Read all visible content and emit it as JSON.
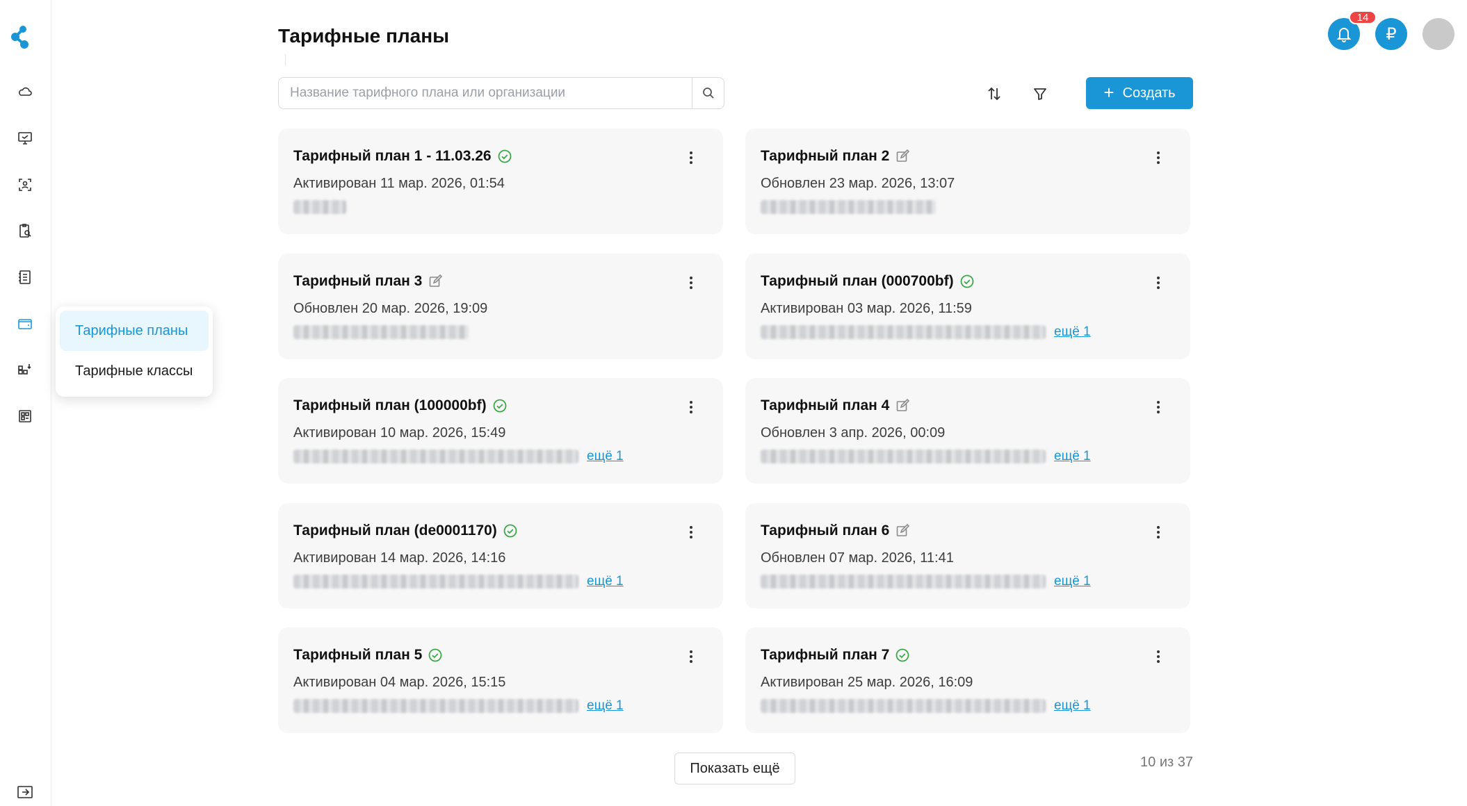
{
  "header": {
    "title": "Тарифные планы",
    "notifications_count": "14",
    "currency_symbol": "₽"
  },
  "nav": {
    "icons": [
      "cloud-icon",
      "monitor-icon",
      "scan-user-icon",
      "clipboard-search-icon",
      "notebook-icon",
      "wallet-icon",
      "hierarchy-icon",
      "widgets-icon"
    ],
    "flyout_items": [
      {
        "label": "Тарифные планы",
        "active": true
      },
      {
        "label": "Тарифные классы",
        "active": false
      }
    ]
  },
  "toolbar": {
    "search_placeholder": "Название тарифного плана или организации",
    "create_label": "Создать"
  },
  "plans": [
    {
      "title": "Тарифный план 1 - 11.03.26",
      "status": "active",
      "subtitle": "Активирован 11 мар. 2026, 01:54",
      "more": ""
    },
    {
      "title": "Тарифный план 2",
      "status": "draft",
      "subtitle": "Обновлен 23 мар. 2026, 13:07",
      "more": ""
    },
    {
      "title": "Тарифный план 3",
      "status": "draft",
      "subtitle": "Обновлен 20 мар. 2026, 19:09",
      "more": ""
    },
    {
      "title": "Тарифный план (000700bf)",
      "status": "active",
      "subtitle": "Активирован 03 мар. 2026, 11:59",
      "more": "ещё 1"
    },
    {
      "title": "Тарифный план (100000bf)",
      "status": "active",
      "subtitle": "Активирован 10 мар. 2026, 15:49",
      "more": "ещё 1"
    },
    {
      "title": "Тарифный план 4",
      "status": "draft",
      "subtitle": "Обновлен 3 апр. 2026, 00:09",
      "more": "ещё 1"
    },
    {
      "title": "Тарифный план (de0001170)",
      "status": "active",
      "subtitle": "Активирован 14 мар. 2026, 14:16",
      "more": "ещё 1"
    },
    {
      "title": "Тарифный план 6",
      "status": "draft",
      "subtitle": "Обновлен 07 мар. 2026, 11:41",
      "more": "ещё 1"
    },
    {
      "title": "Тарифный план 5",
      "status": "active",
      "subtitle": "Активирован 04 мар. 2026, 15:15",
      "more": "ещё 1"
    },
    {
      "title": "Тарифный план 7",
      "status": "active",
      "subtitle": "Активирован 25 мар. 2026, 16:09",
      "more": "ещё 1"
    }
  ],
  "footer": {
    "show_more_label": "Показать ещё",
    "counter": "10 из 37"
  },
  "colors": {
    "accent": "#1a96d6",
    "badge": "#ef4444",
    "active_check": "#3aa845",
    "card_bg": "#f7f7f8"
  }
}
